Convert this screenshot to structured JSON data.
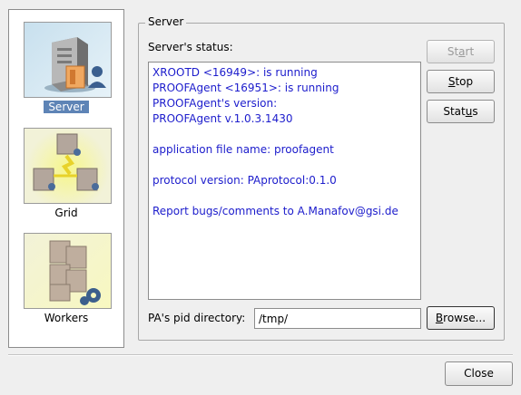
{
  "nav": {
    "items": [
      {
        "label": "Server",
        "selected": true
      },
      {
        "label": "Grid",
        "selected": false
      },
      {
        "label": "Workers",
        "selected": false
      }
    ]
  },
  "server": {
    "group_title": "Server",
    "status_label": "Server's status:",
    "status_lines": [
      "XROOTD <16949>: is running",
      "PROOFAgent <16951>: is running",
      "PROOFAgent's version:",
      "PROOFAgent v.1.0.3.1430",
      "",
      "application file name: proofagent",
      "",
      "protocol version: PAprotocol:0.1.0",
      "",
      "Report bugs/comments to A.Manafov@gsi.de"
    ],
    "buttons": {
      "start": {
        "pre": "St",
        "accel": "a",
        "post": "rt",
        "enabled": false
      },
      "stop": {
        "pre": "",
        "accel": "S",
        "post": "top",
        "enabled": true
      },
      "status": {
        "pre": "Stat",
        "accel": "u",
        "post": "s",
        "enabled": true
      }
    },
    "pid_label": "PA's pid directory:",
    "pid_value": "/tmp/",
    "browse": {
      "pre": "",
      "accel": "B",
      "post": "rowse..."
    }
  },
  "footer": {
    "close_label": "Close"
  },
  "colors": {
    "status_text": "#1c1ccc",
    "selection": "#5e84b6"
  }
}
